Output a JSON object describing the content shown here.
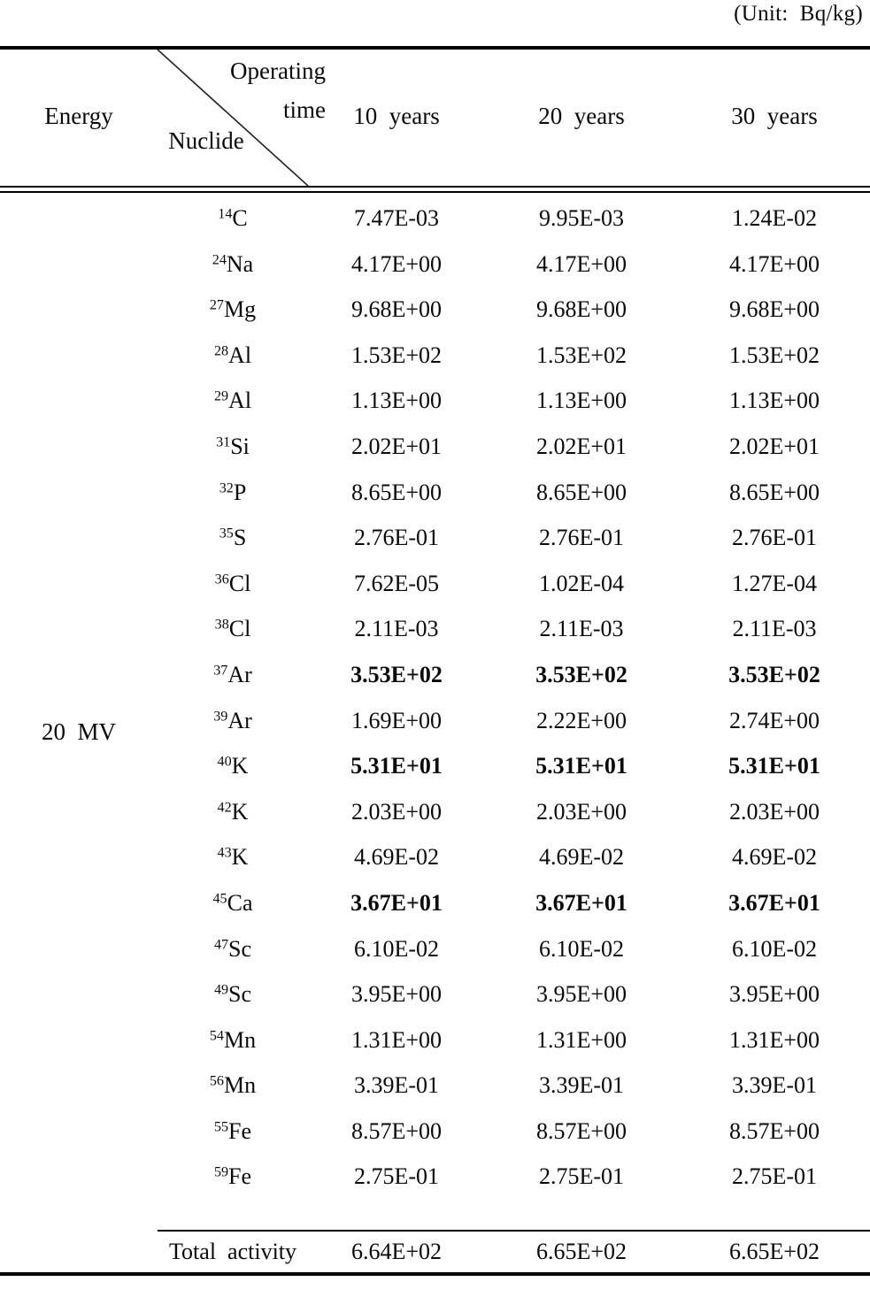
{
  "unit_caption": "(Unit:  Bq/kg)",
  "header": {
    "energy_label": "Energy",
    "operating_time_label": "Operating\ntime",
    "nuclide_label": "Nuclide",
    "columns": [
      "10  years",
      "20  years",
      "30  years"
    ]
  },
  "energy": "20  MV",
  "total_label": "Total  activity",
  "table_data": {
    "type": "table",
    "columns": [
      "Nuclide",
      "10 years",
      "20 years",
      "30 years"
    ],
    "rows": [
      {
        "mass": "14",
        "element": "C",
        "values": [
          "7.47E-03",
          "9.95E-03",
          "1.24E-02"
        ],
        "bold": false
      },
      {
        "mass": "24",
        "element": "Na",
        "values": [
          "4.17E+00",
          "4.17E+00",
          "4.17E+00"
        ],
        "bold": false
      },
      {
        "mass": "27",
        "element": "Mg",
        "values": [
          "9.68E+00",
          "9.68E+00",
          "9.68E+00"
        ],
        "bold": false
      },
      {
        "mass": "28",
        "element": "Al",
        "values": [
          "1.53E+02",
          "1.53E+02",
          "1.53E+02"
        ],
        "bold": false
      },
      {
        "mass": "29",
        "element": "Al",
        "values": [
          "1.13E+00",
          "1.13E+00",
          "1.13E+00"
        ],
        "bold": false
      },
      {
        "mass": "31",
        "element": "Si",
        "values": [
          "2.02E+01",
          "2.02E+01",
          "2.02E+01"
        ],
        "bold": false
      },
      {
        "mass": "32",
        "element": "P",
        "values": [
          "8.65E+00",
          "8.65E+00",
          "8.65E+00"
        ],
        "bold": false
      },
      {
        "mass": "35",
        "element": "S",
        "values": [
          "2.76E-01",
          "2.76E-01",
          "2.76E-01"
        ],
        "bold": false
      },
      {
        "mass": "36",
        "element": "Cl",
        "values": [
          "7.62E-05",
          "1.02E-04",
          "1.27E-04"
        ],
        "bold": false
      },
      {
        "mass": "38",
        "element": "Cl",
        "values": [
          "2.11E-03",
          "2.11E-03",
          "2.11E-03"
        ],
        "bold": false
      },
      {
        "mass": "37",
        "element": "Ar",
        "values": [
          "3.53E+02",
          "3.53E+02",
          "3.53E+02"
        ],
        "bold": true
      },
      {
        "mass": "39",
        "element": "Ar",
        "values": [
          "1.69E+00",
          "2.22E+00",
          "2.74E+00"
        ],
        "bold": false
      },
      {
        "mass": "40",
        "element": "K",
        "values": [
          "5.31E+01",
          "5.31E+01",
          "5.31E+01"
        ],
        "bold": true
      },
      {
        "mass": "42",
        "element": "K",
        "values": [
          "2.03E+00",
          "2.03E+00",
          "2.03E+00"
        ],
        "bold": false
      },
      {
        "mass": "43",
        "element": "K",
        "values": [
          "4.69E-02",
          "4.69E-02",
          "4.69E-02"
        ],
        "bold": false
      },
      {
        "mass": "45",
        "element": "Ca",
        "values": [
          "3.67E+01",
          "3.67E+01",
          "3.67E+01"
        ],
        "bold": true
      },
      {
        "mass": "47",
        "element": "Sc",
        "values": [
          "6.10E-02",
          "6.10E-02",
          "6.10E-02"
        ],
        "bold": false
      },
      {
        "mass": "49",
        "element": "Sc",
        "values": [
          "3.95E+00",
          "3.95E+00",
          "3.95E+00"
        ],
        "bold": false
      },
      {
        "mass": "54",
        "element": "Mn",
        "values": [
          "1.31E+00",
          "1.31E+00",
          "1.31E+00"
        ],
        "bold": false
      },
      {
        "mass": "56",
        "element": "Mn",
        "values": [
          "3.39E-01",
          "3.39E-01",
          "3.39E-01"
        ],
        "bold": false
      },
      {
        "mass": "55",
        "element": "Fe",
        "values": [
          "8.57E+00",
          "8.57E+00",
          "8.57E+00"
        ],
        "bold": false
      },
      {
        "mass": "59",
        "element": "Fe",
        "values": [
          "2.75E-01",
          "2.75E-01",
          "2.75E-01"
        ],
        "bold": false
      }
    ],
    "total": [
      "6.64E+02",
      "6.65E+02",
      "6.65E+02"
    ]
  },
  "colors": {
    "text": "#0a0a0a",
    "rule": "#000000",
    "background": "#ffffff"
  }
}
